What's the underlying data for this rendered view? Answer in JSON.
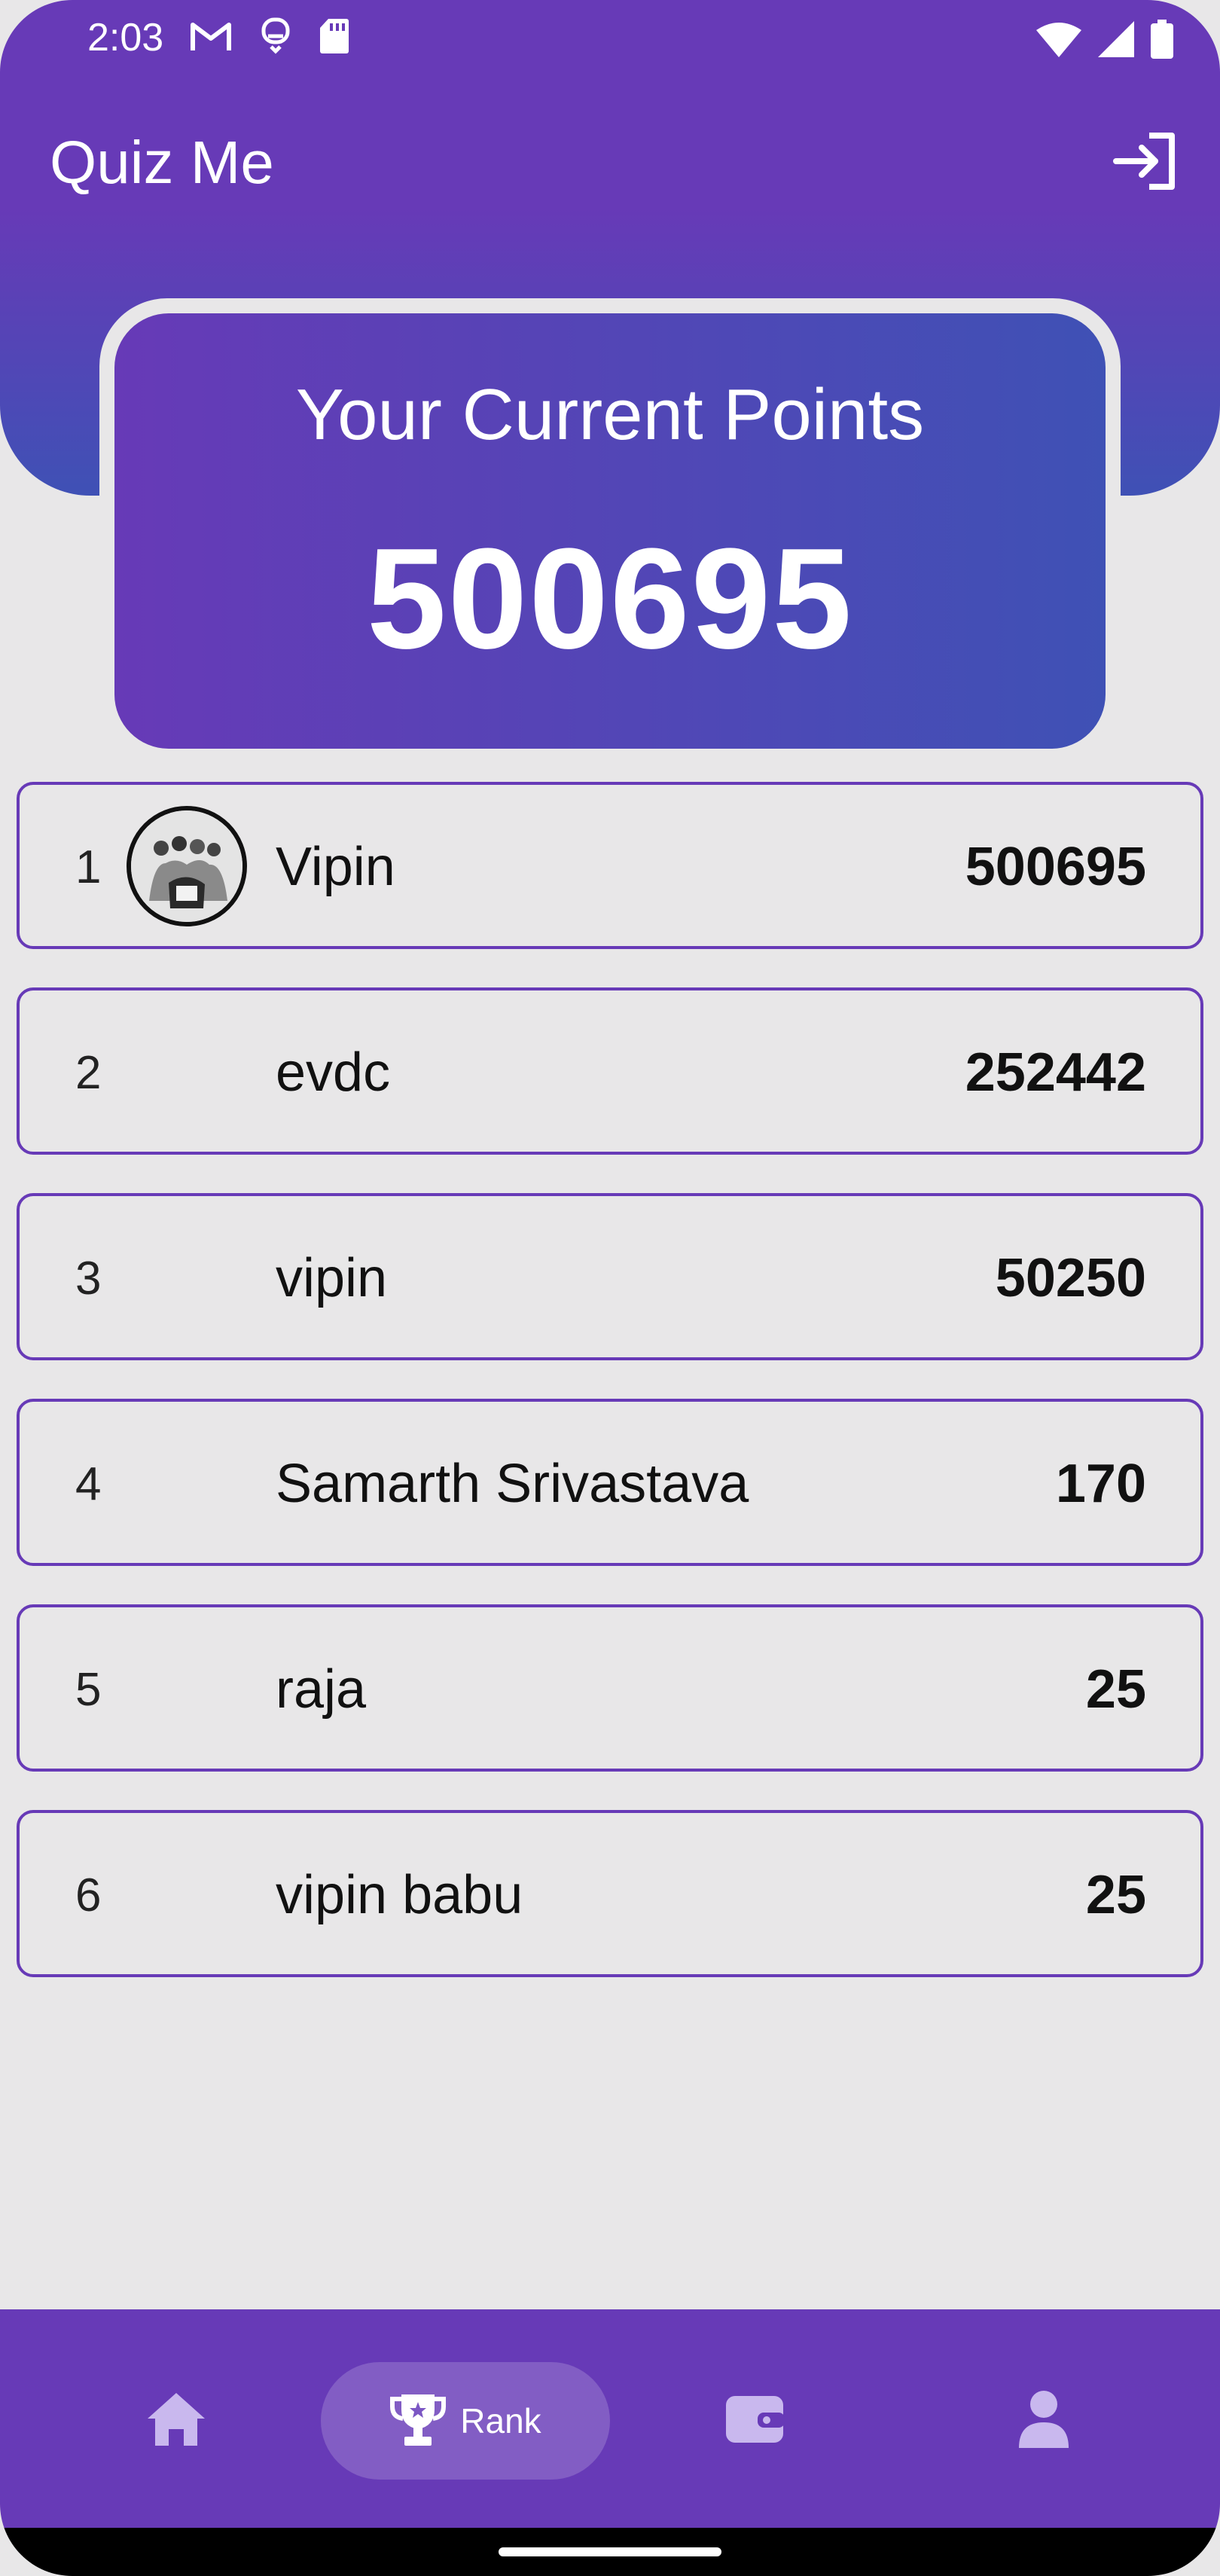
{
  "status_bar": {
    "time": "2:03",
    "left_icons": [
      "gmail-icon",
      "notification-icon",
      "sd-card-icon"
    ],
    "right_icons": [
      "wifi-icon",
      "signal-icon",
      "battery-icon"
    ]
  },
  "app_bar": {
    "title": "Quiz Me",
    "logout_icon": "logout-icon"
  },
  "points_card": {
    "label": "Your Current Points",
    "value": "500695"
  },
  "leaderboard": [
    {
      "rank": "1",
      "name": "Vipin",
      "points": "500695",
      "has_avatar": true
    },
    {
      "rank": "2",
      "name": "evdc",
      "points": "252442",
      "has_avatar": false
    },
    {
      "rank": "3",
      "name": "vipin",
      "points": "50250",
      "has_avatar": false
    },
    {
      "rank": "4",
      "name": "Samarth Srivastava",
      "points": "170",
      "has_avatar": false
    },
    {
      "rank": "5",
      "name": "raja",
      "points": "25",
      "has_avatar": false
    },
    {
      "rank": "6",
      "name": "vipin babu",
      "points": "25",
      "has_avatar": false
    }
  ],
  "bottom_nav": {
    "items": [
      {
        "icon": "home-icon",
        "label": ""
      },
      {
        "icon": "trophy-icon",
        "label": "Rank",
        "selected": true
      },
      {
        "icon": "wallet-icon",
        "label": ""
      },
      {
        "icon": "person-icon",
        "label": ""
      }
    ]
  },
  "colors": {
    "primary": "#673ab7",
    "secondary": "#3f51b5",
    "background": "#e8e7e8",
    "nav_icon_inactive": "#c9b8ee"
  }
}
